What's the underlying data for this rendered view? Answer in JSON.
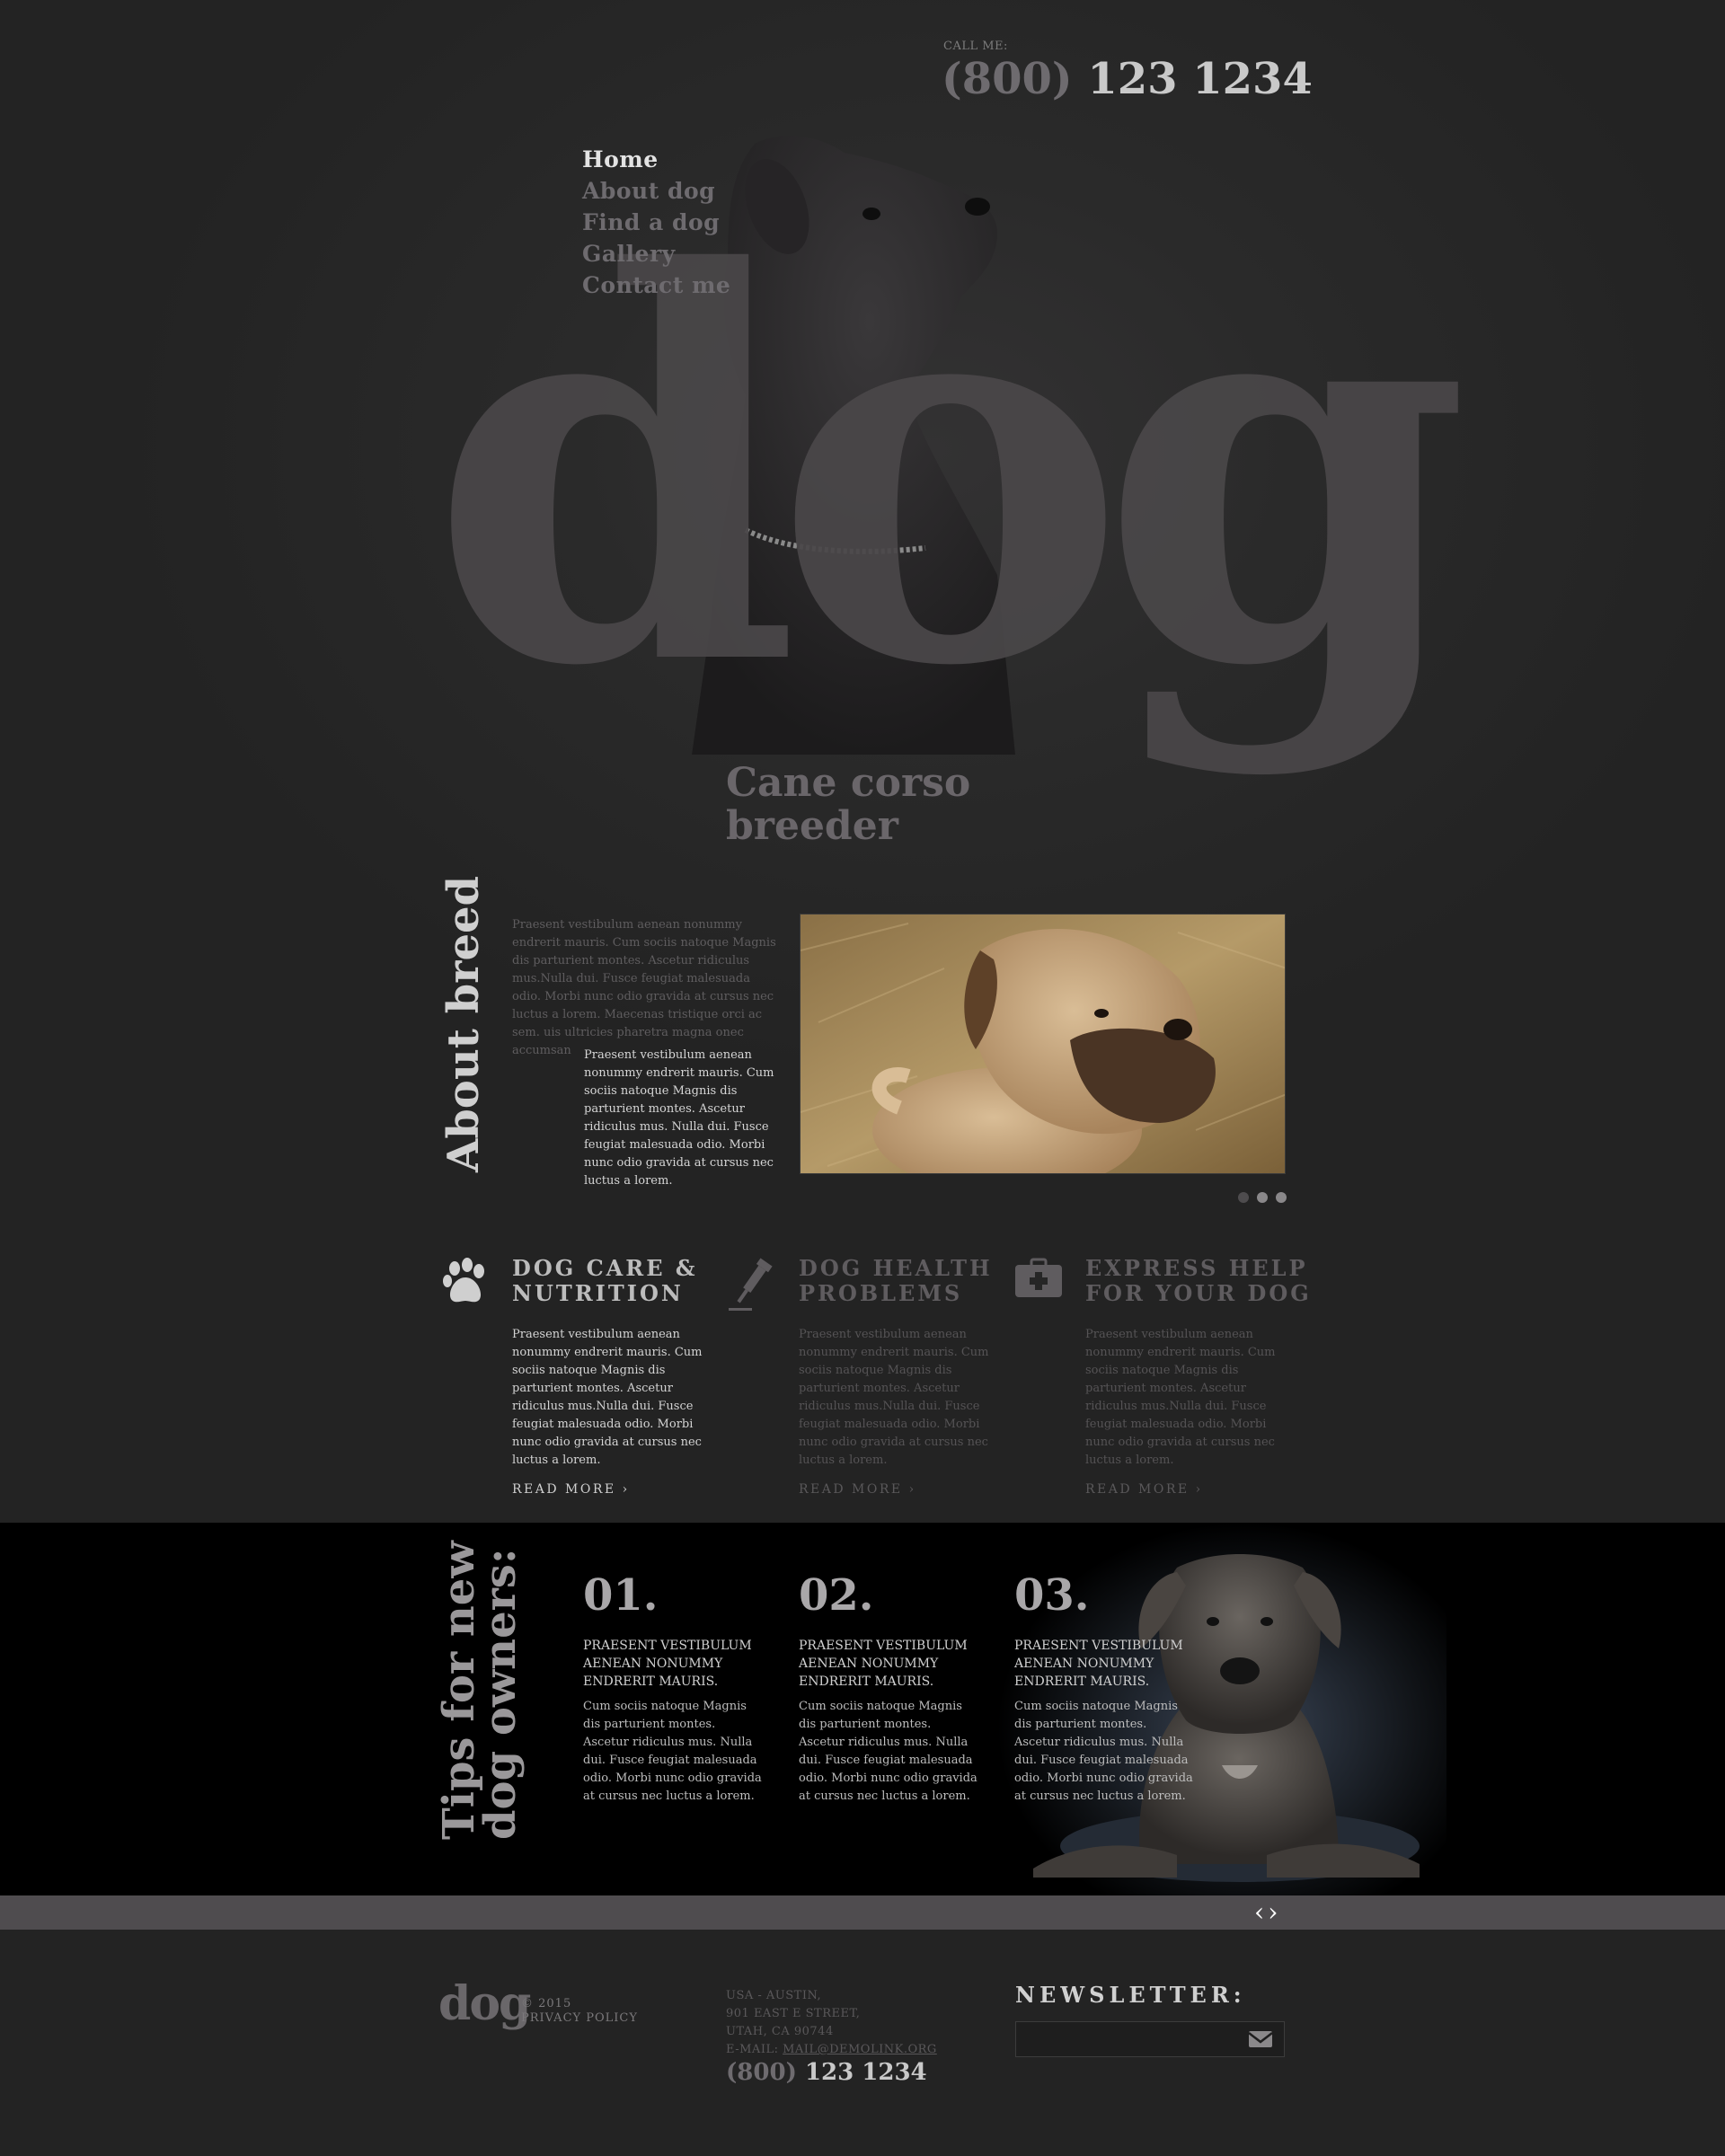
{
  "header": {
    "call_label": "CALL ME:",
    "phone_prefix": "(800)",
    "phone_number": "123 1234"
  },
  "nav": {
    "items": [
      {
        "label": "Home",
        "active": true
      },
      {
        "label": "About dog",
        "active": false
      },
      {
        "label": "Find a dog",
        "active": false
      },
      {
        "label": "Gallery",
        "active": false
      },
      {
        "label": "Contact me",
        "active": false
      }
    ]
  },
  "hero": {
    "big_word": "dog",
    "tagline_line1": "Cane corso",
    "tagline_line2": "breeder"
  },
  "about": {
    "title": "About breed",
    "text_muted": "Praesent vestibulum aenean nonummy endrerit mauris. Cum sociis natoque Magnis dis parturient montes. Ascetur ridiculus mus.Nulla dui. Fusce feugiat malesuada odio. Morbi nunc odio gravida at cursus nec luctus a lorem. Maecenas tristique orci ac sem. uis ultricies pharetra magna onec accumsan",
    "text_main": "Praesent vestibulum aenean nonummy endrerit mauris. Cum sociis natoque Magnis dis parturient montes. Ascetur ridiculus mus. Nulla dui. Fusce feugiat malesuada odio. Morbi nunc odio gravida at cursus nec luctus a lorem.",
    "slider_dots": 3,
    "slider_active": 1
  },
  "features": [
    {
      "icon": "paw-icon",
      "title_line1": "DOG CARE &",
      "title_line2": "NUTRITION",
      "text": "Praesent vestibulum aenean nonummy endrerit mauris. Cum sociis natoque Magnis dis parturient montes. Ascetur ridiculus mus.Nulla dui. Fusce feugiat malesuada odio. Morbi nunc odio gravida at cursus nec luctus a lorem.",
      "more": "READ MORE ›"
    },
    {
      "icon": "syringe-icon",
      "title_line1": "DOG HEALTH",
      "title_line2": "PROBLEMS",
      "text": "Praesent vestibulum aenean nonummy endrerit mauris. Cum sociis natoque Magnis dis parturient montes. Ascetur ridiculus mus.Nulla dui. Fusce feugiat malesuada odio. Morbi nunc odio gravida at cursus nec luctus a lorem.",
      "more": "READ MORE ›"
    },
    {
      "icon": "first-aid-kit-icon",
      "title_line1": "EXPRESS HELP",
      "title_line2": "FOR YOUR DOG",
      "text": "Praesent vestibulum aenean nonummy endrerit mauris. Cum sociis natoque Magnis dis parturient montes. Ascetur ridiculus mus.Nulla dui. Fusce feugiat malesuada odio. Morbi nunc odio gravida at cursus nec luctus a lorem.",
      "more": "READ MORE ›"
    }
  ],
  "tips": {
    "title_line1": "Tips for new",
    "title_line2": "dog owners:",
    "items": [
      {
        "num": "01.",
        "title": "PRAESENT VESTIBULUM AENEAN NONUMMY ENDRERIT MAURIS.",
        "text": "Cum sociis natoque Magnis dis parturient montes. Ascetur ridiculus mus. Nulla dui. Fusce feugiat malesuada odio. Morbi nunc odio gravida at cursus nec luctus a lorem."
      },
      {
        "num": "02.",
        "title": "PRAESENT VESTIBULUM AENEAN NONUMMY ENDRERIT MAURIS.",
        "text": "Cum sociis natoque Magnis dis parturient montes. Ascetur ridiculus mus. Nulla dui. Fusce feugiat malesuada odio. Morbi nunc odio gravida at cursus nec luctus a lorem."
      },
      {
        "num": "03.",
        "title": "PRAESENT VESTIBULUM AENEAN NONUMMY ENDRERIT MAURIS.",
        "text": "Cum sociis natoque Magnis dis parturient montes. Ascetur ridiculus mus. Nulla dui. Fusce feugiat malesuada odio. Morbi nunc odio gravida at cursus nec luctus a lorem."
      }
    ],
    "arrows": "‹›"
  },
  "footer": {
    "logo": "dog",
    "copyright": "© 2015",
    "privacy": "PRIVACY POLICY",
    "addr_line1": "USA - AUSTIN,",
    "addr_line2": "901 EAST E STREET,",
    "addr_line3": "UTAH, CA 90744",
    "email_label": "E-MAIL: ",
    "email": "MAIL@DEMOLINK.ORG",
    "phone_prefix": "(800)",
    "phone_number": "123 1234",
    "newsletter_title": "NEWSLETTER:",
    "newsletter_value": ""
  },
  "colors": {
    "background": "#262626",
    "accent_muted": "#4a4749",
    "footer_bar": "#4f4c4f"
  }
}
